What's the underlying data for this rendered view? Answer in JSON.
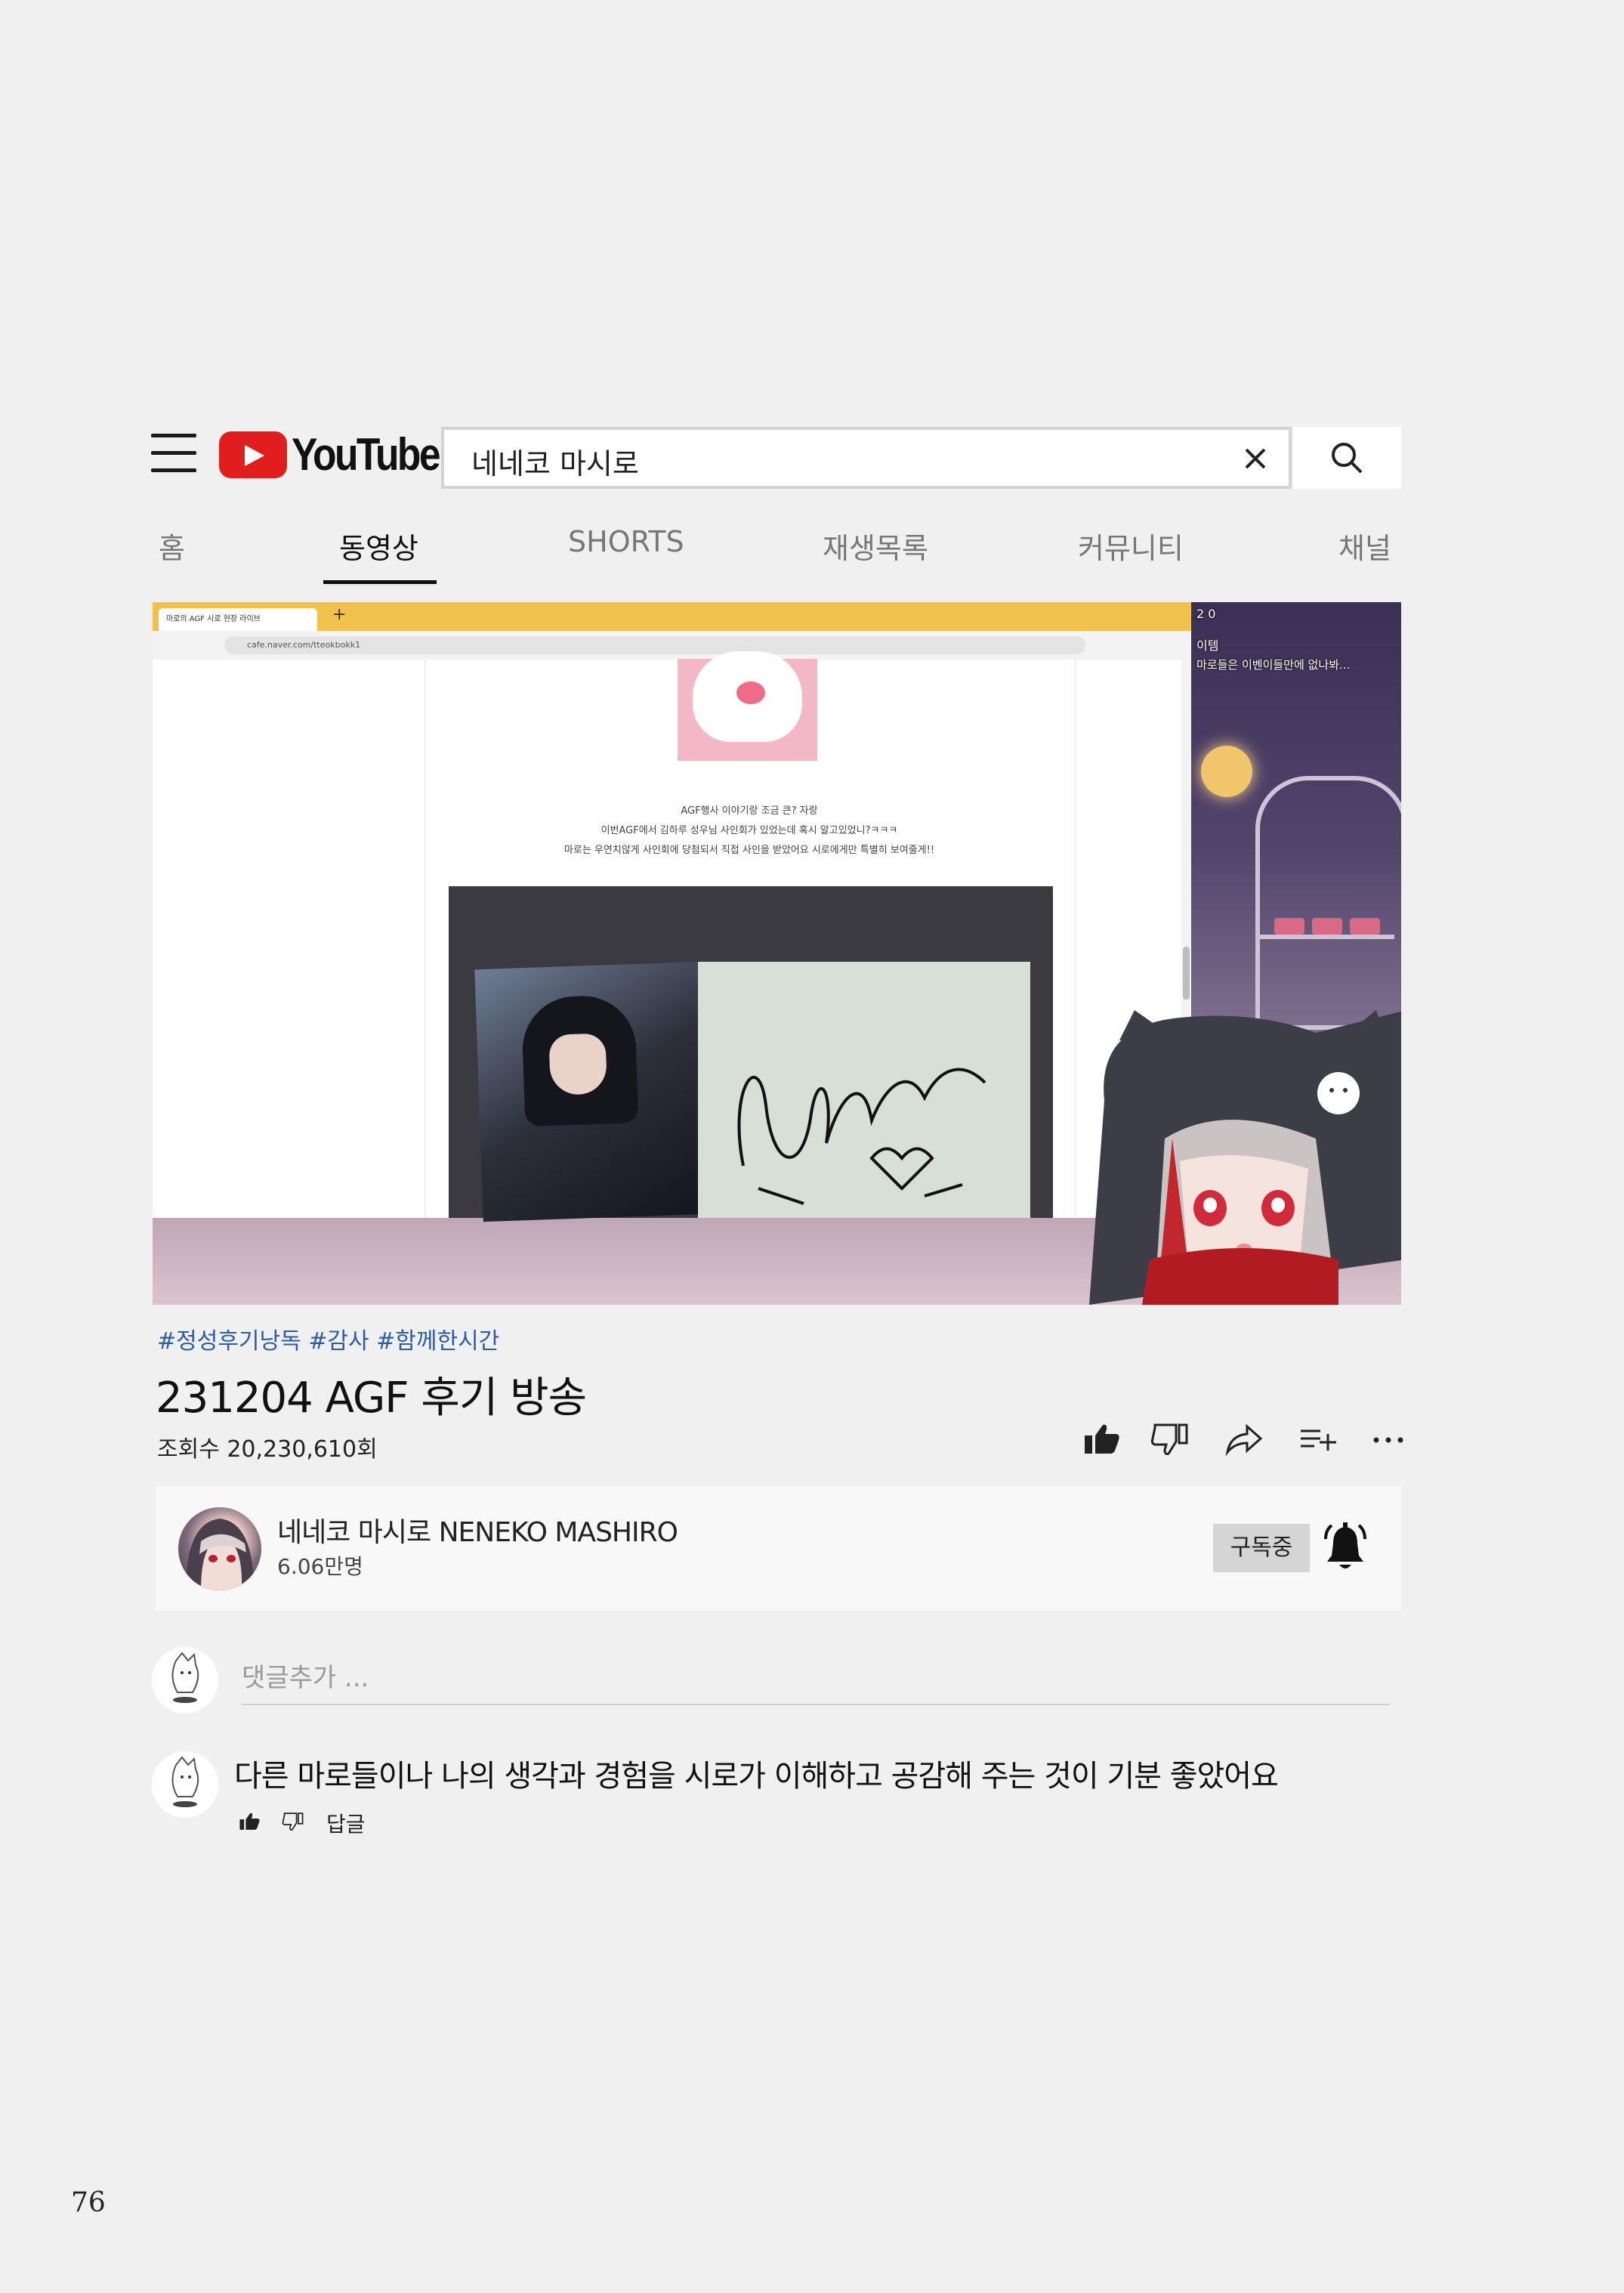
{
  "header": {
    "logo_text": "YouTube",
    "search_value": "네네코 마시로"
  },
  "tabs": [
    {
      "label": "홈",
      "active": false
    },
    {
      "label": "동영상",
      "active": true
    },
    {
      "label": "SHORTS",
      "active": false
    },
    {
      "label": "재생목록",
      "active": false
    },
    {
      "label": "커뮤니티",
      "active": false
    },
    {
      "label": "채널",
      "active": false
    }
  ],
  "video": {
    "browser_tab_title": "마로의 AGF 시로 현장 라이브",
    "browser_url": "cafe.naver.com/tteokbokk1",
    "post_lines": [
      "AGF행사 이야기랑 조금 큰? 자랑",
      "이번AGF에서 김하루 성우님 사인회가 있었는데 혹시 알고있었니?ㅋㅋㅋ",
      "마로는 우연치않게 사인회에 당첨되서 직접 사인을 받았어요 시로에게만 특별히 보여줄게!!"
    ],
    "overlay_line1": "2 0",
    "overlay_line2": "이템",
    "overlay_line3": "마로들은 이벤이들만에 없나봐..."
  },
  "meta": {
    "hashtags": "#정성후기낭독 #감사 #함께한시간",
    "title": "231204 AGF 후기 방송",
    "views": "조회수 20,230,610회"
  },
  "actions": [
    "like-icon",
    "dislike-icon",
    "share-icon",
    "add-to-playlist-icon",
    "more-icon"
  ],
  "channel": {
    "name": "네네코 마시로 NENEKO MASHIRO",
    "subscribers": "6.06만명",
    "subscribe_label": "구독중"
  },
  "comments": {
    "placeholder": "댓글추가 ...",
    "items": [
      {
        "text": "다른 마로들이나 나의 생각과 경험을 시로가 이해하고 공감해 주는 것이 기분 좋았어요",
        "reply_label": "답글"
      }
    ]
  },
  "page_number": "76",
  "colors": {
    "background": "#eff0ef",
    "youtube_red": "#e21d1d",
    "hashtag": "#2a5caa",
    "browser_tabbar": "#f0c14b"
  }
}
